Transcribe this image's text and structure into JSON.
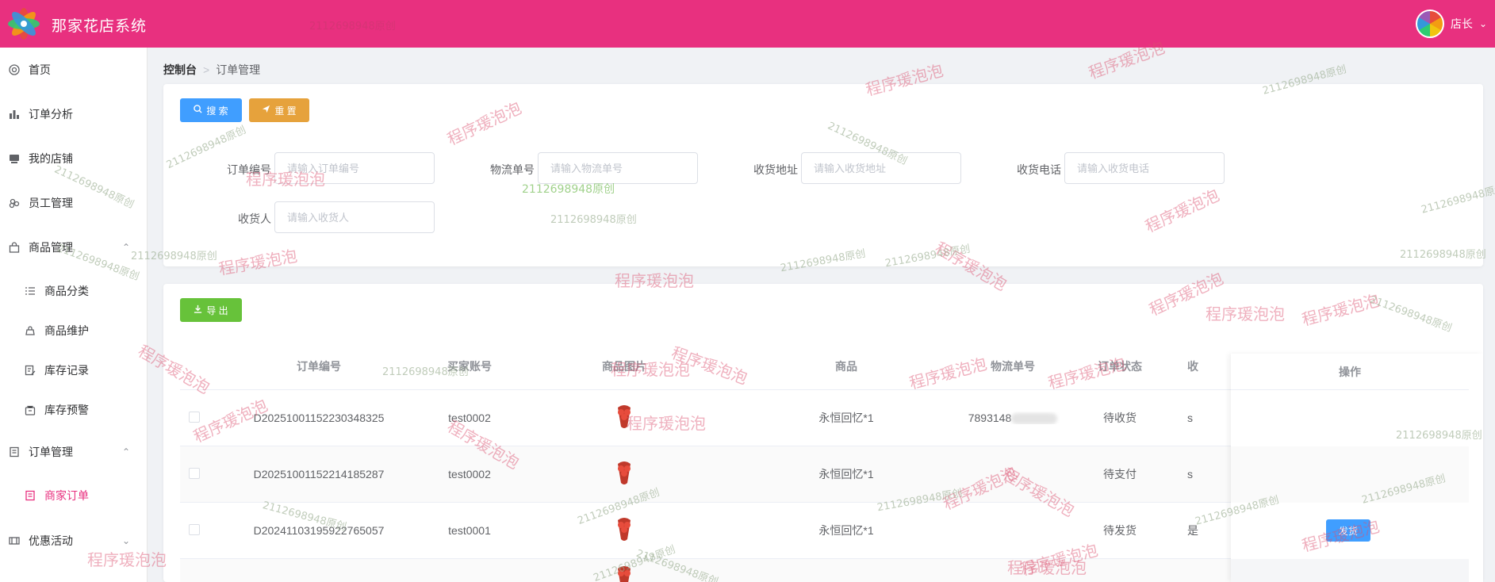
{
  "app": {
    "title": "那家花店系统",
    "user_name": "店长"
  },
  "sidebar": {
    "items": [
      {
        "label": "首页"
      },
      {
        "label": "订单分析"
      },
      {
        "label": "我的店铺"
      },
      {
        "label": "员工管理"
      },
      {
        "label": "商品管理"
      },
      {
        "label": "商品分类"
      },
      {
        "label": "商品维护"
      },
      {
        "label": "库存记录"
      },
      {
        "label": "库存预警"
      },
      {
        "label": "订单管理"
      },
      {
        "label": "商家订单"
      },
      {
        "label": "优惠活动"
      }
    ]
  },
  "breadcrumb": {
    "first": "控制台",
    "current": "订单管理"
  },
  "search": {
    "search_label": "搜 索",
    "reset_label": "重 置",
    "fields": [
      {
        "label": "订单编号",
        "placeholder": "请输入订单编号"
      },
      {
        "label": "物流单号",
        "placeholder": "请输入物流单号"
      },
      {
        "label": "收货地址",
        "placeholder": "请输入收货地址"
      },
      {
        "label": "收货电话",
        "placeholder": "请输入收货电话"
      },
      {
        "label": "收货人",
        "placeholder": "请输入收货人"
      }
    ]
  },
  "table": {
    "export_label": "导 出",
    "columns": [
      "订单编号",
      "买家账号",
      "商品图片",
      "商品",
      "物流单号",
      "订单状态",
      "收",
      "操作"
    ],
    "rows": [
      {
        "order_no": "D20251001152230348325",
        "buyer": "test0002",
        "goods": "永恒回忆*1",
        "logistics": "7893148",
        "status": "待收货",
        "addr": "s"
      },
      {
        "order_no": "D20251001152214185287",
        "buyer": "test0002",
        "goods": "永恒回忆*1",
        "logistics": "",
        "status": "待支付",
        "addr": "s"
      },
      {
        "order_no": "D20241103195922765057",
        "buyer": "test0001",
        "goods": "永恒回忆*1",
        "logistics": "",
        "status": "待发货",
        "addr": "是"
      }
    ],
    "ship_label": "发货"
  },
  "watermarks": {
    "pink": "程序瑗泡泡",
    "green": "2112698948原创"
  },
  "colors": {
    "header": "#e8307f",
    "primary": "#409eff",
    "warning": "#e6a23c",
    "success": "#67c23a"
  }
}
